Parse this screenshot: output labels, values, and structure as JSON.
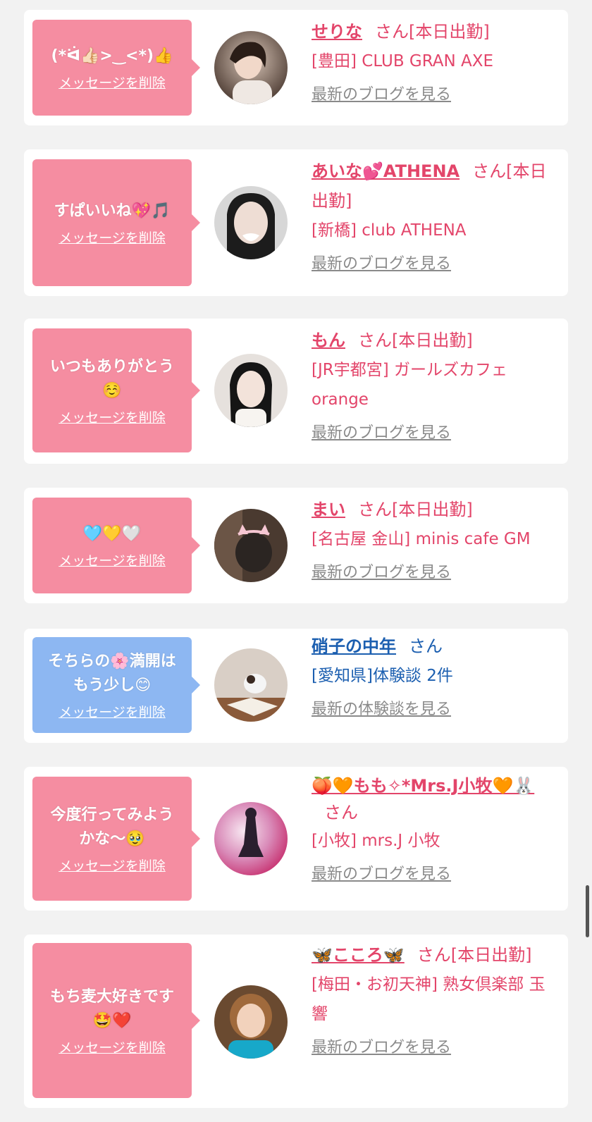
{
  "cards": [
    {
      "message": "(*ᐛ👍🏻>‿<*)👍",
      "delete_label": "メッセージを削除",
      "name": "せりな",
      "san": "さん[本日出勤]",
      "shop": "[豊田] CLUB GRAN AXE",
      "link": "最新のブログを見る",
      "avatar": "avatar-photo-1"
    },
    {
      "message": "すぱいいね💖🎵",
      "delete_label": "メッセージを削除",
      "name": "あいな💕ATHENA",
      "san": "さん[本日出勤]",
      "shop": "[新橋] club ATHENA",
      "link": "最新のブログを見る",
      "avatar": "avatar-photo-2"
    },
    {
      "message": "いつもありがとう\n☺️",
      "delete_label": "メッセージを削除",
      "name": "もん",
      "san": "さん[本日出勤]",
      "shop": "[JR宇都宮] ガールズカフェ orange",
      "link": "最新のブログを見る",
      "avatar": "avatar-photo-3"
    },
    {
      "message": "🩵💛🤍",
      "delete_label": "メッセージを削除",
      "name": "まい",
      "san": "さん[本日出勤]",
      "shop": "[名古屋 金山] minis cafe GM",
      "link": "最新のブログを見る",
      "avatar": "avatar-photo-4"
    },
    {
      "message": "そちらの🌸満開は\nもう少し😊",
      "delete_label": "メッセージを削除",
      "name": "硝子の中年",
      "san": "さん",
      "shop": "[愛知県]体験談 2件",
      "link": "最新の体験談を見る",
      "avatar": "avatar-photo-5"
    },
    {
      "message": "今度行ってみよう\nかな〜🥹",
      "delete_label": "メッセージを削除",
      "name": "🍑🧡もも✧*Mrs.J小牧🧡🐰",
      "san": "さん",
      "shop": "[小牧] mrs.J 小牧",
      "link": "最新のブログを見る",
      "avatar": "avatar-photo-6"
    },
    {
      "message": "もち麦大好きです\n🤩❤️",
      "delete_label": "メッセージを削除",
      "name": "🦋こころ🦋",
      "san": "さん[本日出勤]",
      "shop": "[梅田・お初天神] 熟女倶楽部 玉響",
      "link": "最新のブログを見る",
      "avatar": "avatar-photo-7"
    }
  ],
  "colors": {
    "pink_bubble": "#f58da1",
    "blue_bubble": "#8db7f2",
    "pink_text": "#e3456a",
    "blue_text": "#1c5fb0"
  }
}
